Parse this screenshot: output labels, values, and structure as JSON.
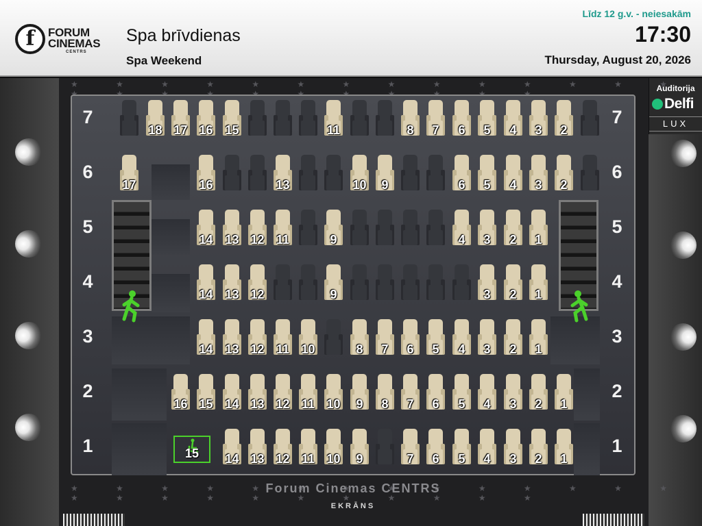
{
  "header": {
    "logo_line1": "FORUM",
    "logo_line2": "CINEMAS",
    "logo_line3": "CENTRS",
    "title": "Spa brīvdienas",
    "subtitle": "Spa Weekend",
    "age_rating": "Līdz 12 g.v. -  neiesakām",
    "time": "17:30",
    "date": "Thursday, August 20, 2026"
  },
  "auditorium": {
    "label": "Auditorija",
    "brand": "Delfi",
    "type": "LUX"
  },
  "screen": {
    "cinema_name": "Forum Cinemas CENTRS",
    "label": "EKRĀNS"
  },
  "row_labels": [
    "7",
    "6",
    "5",
    "4",
    "3",
    "2",
    "1"
  ],
  "rows": [
    {
      "row": "7",
      "seats": [
        {
          "n": "",
          "s": "taken"
        },
        {
          "n": "18",
          "s": "free"
        },
        {
          "n": "17",
          "s": "free"
        },
        {
          "n": "16",
          "s": "free"
        },
        {
          "n": "15",
          "s": "free"
        },
        {
          "n": "",
          "s": "taken"
        },
        {
          "n": "",
          "s": "taken"
        },
        {
          "n": "",
          "s": "taken"
        },
        {
          "n": "11",
          "s": "free"
        },
        {
          "n": "",
          "s": "taken"
        },
        {
          "n": "",
          "s": "taken"
        },
        {
          "n": "8",
          "s": "free"
        },
        {
          "n": "7",
          "s": "free"
        },
        {
          "n": "6",
          "s": "free"
        },
        {
          "n": "5",
          "s": "free"
        },
        {
          "n": "4",
          "s": "free"
        },
        {
          "n": "3",
          "s": "free"
        },
        {
          "n": "2",
          "s": "free"
        },
        {
          "n": "",
          "s": "taken"
        }
      ]
    },
    {
      "row": "6",
      "seats": [
        {
          "n": "17",
          "s": "free"
        },
        {
          "n": "16",
          "s": "free"
        },
        {
          "n": "",
          "s": "taken"
        },
        {
          "n": "",
          "s": "taken"
        },
        {
          "n": "13",
          "s": "free"
        },
        {
          "n": "",
          "s": "taken"
        },
        {
          "n": "",
          "s": "taken"
        },
        {
          "n": "10",
          "s": "free"
        },
        {
          "n": "9",
          "s": "free"
        },
        {
          "n": "",
          "s": "taken"
        },
        {
          "n": "",
          "s": "taken"
        },
        {
          "n": "6",
          "s": "free"
        },
        {
          "n": "5",
          "s": "free"
        },
        {
          "n": "4",
          "s": "free"
        },
        {
          "n": "3",
          "s": "free"
        },
        {
          "n": "2",
          "s": "free"
        },
        {
          "n": "",
          "s": "taken"
        }
      ]
    },
    {
      "row": "5",
      "seats": [
        {
          "n": "14",
          "s": "free"
        },
        {
          "n": "13",
          "s": "free"
        },
        {
          "n": "12",
          "s": "free"
        },
        {
          "n": "11",
          "s": "free"
        },
        {
          "n": "",
          "s": "taken"
        },
        {
          "n": "9",
          "s": "free"
        },
        {
          "n": "",
          "s": "taken"
        },
        {
          "n": "",
          "s": "taken"
        },
        {
          "n": "",
          "s": "taken"
        },
        {
          "n": "",
          "s": "taken"
        },
        {
          "n": "4",
          "s": "free"
        },
        {
          "n": "3",
          "s": "free"
        },
        {
          "n": "2",
          "s": "free"
        },
        {
          "n": "1",
          "s": "free"
        }
      ]
    },
    {
      "row": "4",
      "seats": [
        {
          "n": "14",
          "s": "free"
        },
        {
          "n": "13",
          "s": "free"
        },
        {
          "n": "12",
          "s": "free"
        },
        {
          "n": "",
          "s": "taken"
        },
        {
          "n": "",
          "s": "taken"
        },
        {
          "n": "9",
          "s": "free"
        },
        {
          "n": "",
          "s": "taken"
        },
        {
          "n": "",
          "s": "taken"
        },
        {
          "n": "",
          "s": "taken"
        },
        {
          "n": "",
          "s": "taken"
        },
        {
          "n": "",
          "s": "taken"
        },
        {
          "n": "3",
          "s": "free"
        },
        {
          "n": "2",
          "s": "free"
        },
        {
          "n": "1",
          "s": "free"
        }
      ]
    },
    {
      "row": "3",
      "seats": [
        {
          "n": "14",
          "s": "free"
        },
        {
          "n": "13",
          "s": "free"
        },
        {
          "n": "12",
          "s": "free"
        },
        {
          "n": "11",
          "s": "free"
        },
        {
          "n": "10",
          "s": "free"
        },
        {
          "n": "",
          "s": "taken"
        },
        {
          "n": "8",
          "s": "free"
        },
        {
          "n": "7",
          "s": "free"
        },
        {
          "n": "6",
          "s": "free"
        },
        {
          "n": "5",
          "s": "free"
        },
        {
          "n": "4",
          "s": "free"
        },
        {
          "n": "3",
          "s": "free"
        },
        {
          "n": "2",
          "s": "free"
        },
        {
          "n": "1",
          "s": "free"
        }
      ]
    },
    {
      "row": "2",
      "seats": [
        {
          "n": "16",
          "s": "free"
        },
        {
          "n": "15",
          "s": "free"
        },
        {
          "n": "14",
          "s": "free"
        },
        {
          "n": "13",
          "s": "free"
        },
        {
          "n": "12",
          "s": "free"
        },
        {
          "n": "11",
          "s": "free"
        },
        {
          "n": "10",
          "s": "free"
        },
        {
          "n": "9",
          "s": "free"
        },
        {
          "n": "8",
          "s": "free"
        },
        {
          "n": "7",
          "s": "free"
        },
        {
          "n": "6",
          "s": "free"
        },
        {
          "n": "5",
          "s": "free"
        },
        {
          "n": "4",
          "s": "free"
        },
        {
          "n": "3",
          "s": "free"
        },
        {
          "n": "2",
          "s": "free"
        },
        {
          "n": "1",
          "s": "free"
        }
      ]
    },
    {
      "row": "1",
      "seats": [
        {
          "n": "14",
          "s": "free"
        },
        {
          "n": "13",
          "s": "free"
        },
        {
          "n": "12",
          "s": "free"
        },
        {
          "n": "11",
          "s": "free"
        },
        {
          "n": "10",
          "s": "free"
        },
        {
          "n": "9",
          "s": "free"
        },
        {
          "n": "",
          "s": "taken"
        },
        {
          "n": "7",
          "s": "free"
        },
        {
          "n": "6",
          "s": "free"
        },
        {
          "n": "5",
          "s": "free"
        },
        {
          "n": "4",
          "s": "free"
        },
        {
          "n": "3",
          "s": "free"
        },
        {
          "n": "2",
          "s": "free"
        },
        {
          "n": "1",
          "s": "free"
        }
      ]
    }
  ],
  "wheelchair_seat": {
    "row": "1",
    "n": "15"
  },
  "colors": {
    "free": "#dcd0b2",
    "taken": "#35373c",
    "accent": "#1f9a8c",
    "exit": "#4bd12b"
  }
}
